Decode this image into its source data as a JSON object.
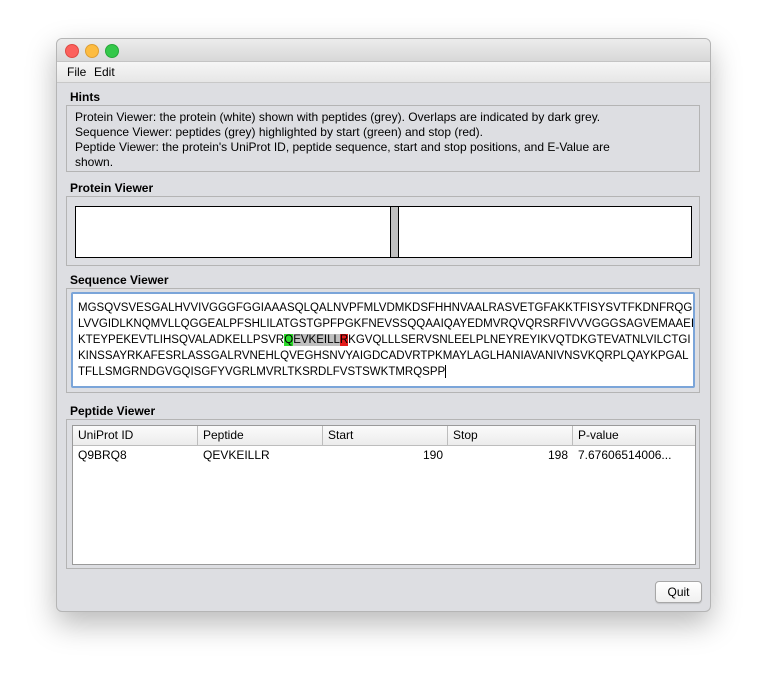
{
  "menu": {
    "file": "File",
    "edit": "Edit"
  },
  "hints": {
    "title": "Hints",
    "lines": [
      "Protein Viewer: the protein (white) shown with peptides (grey). Overlaps are indicated by dark grey.",
      "Sequence Viewer: peptides (grey) highlighted by start (green) and stop (red).",
      "Peptide Viewer: the protein's UniProt ID, peptide sequence, start and stop positions, and E-Value are",
      "shown."
    ]
  },
  "protein_viewer": {
    "title": "Protein Viewer",
    "peptide_start_fraction": 0.51,
    "peptide_end_fraction": 0.525
  },
  "sequence_viewer": {
    "title": "Sequence Viewer",
    "line1": "MGSQVSVESGALHVVIVGGGFGGIAAASQLQALNVPFMLVDMKDSFHHNVAALRASVETGFAKKTFISYSVTFKDNFRQG",
    "line2": "LVVGIDLKNQMVLLQGGEALPFSHLILATGSTGPFPGKFNEVSSQQAAIQAYEDMVRQVQRSRFIVVVGGGSAGVEMAAEI",
    "line3_before": "KTEYPEKEVTLIHSQVALADKELLPSVR",
    "line3_start": "Q",
    "line3_mid": "EVKEILL",
    "line3_stop": "R",
    "line3_after": "KGVQLLLSERVSNLEELPLNEYREYIKVQTDKGTEVATNLVILCTGI",
    "line4": "KINSSAYRKAFESRLASSGALRVNEHLQVEGHSNVYAIGDCADVRTPKMAYLAGLHANIAVANIVNSVKQRPLQAYKPGAL",
    "line5": "TFLLSMGRNDGVGQISGFYVGRLMVRLTKSRDLFVSTSWKTMRQSPP",
    "colors": {
      "start": "#2bdc2b",
      "peptide": "#c0c0c0",
      "stop": "#e31a1a"
    }
  },
  "peptide_viewer": {
    "title": "Peptide Viewer",
    "columns": [
      "UniProt ID",
      "Peptide",
      "Start",
      "Stop",
      "P-value"
    ],
    "rows": [
      {
        "uniprot_id": "Q9BRQ8",
        "peptide": "QEVKEILLR",
        "start": "190",
        "stop": "198",
        "p_value": "7.67606514006..."
      }
    ]
  },
  "quit_label": "Quit"
}
